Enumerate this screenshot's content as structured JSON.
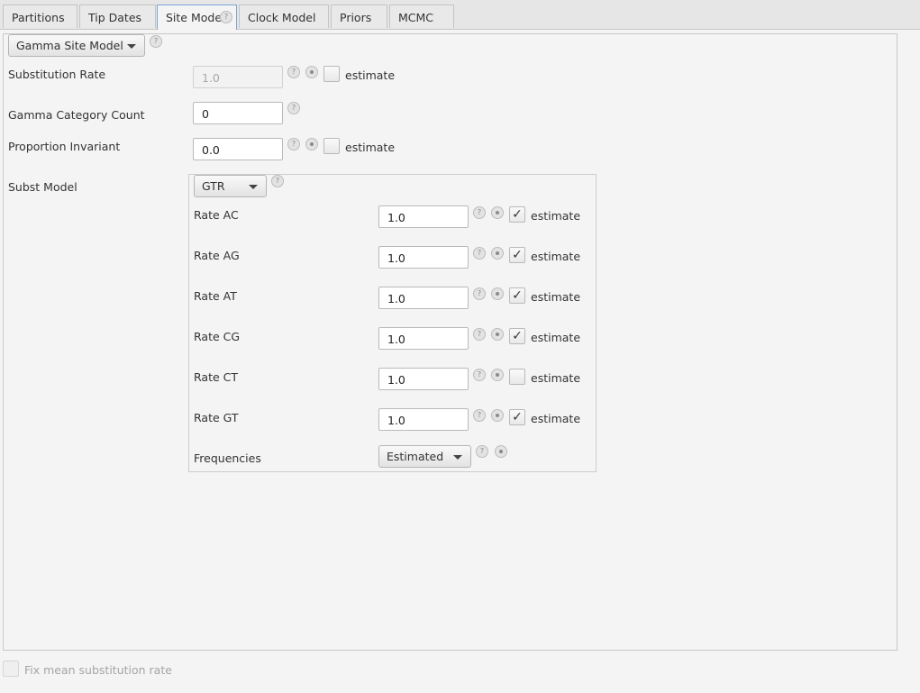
{
  "tabs": [
    {
      "label": "Partitions"
    },
    {
      "label": "Tip Dates"
    },
    {
      "label": "Site Model"
    },
    {
      "label": "Clock Model"
    },
    {
      "label": "Priors"
    },
    {
      "label": "MCMC"
    }
  ],
  "help_glyph": "?",
  "site_model": {
    "selected": "Gamma Site Model",
    "substitution_rate": {
      "label": "Substitution Rate",
      "value": "1.0",
      "enabled": false,
      "estimate": false
    },
    "gamma_category_count": {
      "label": "Gamma Category Count",
      "value": "0"
    },
    "proportion_invariant": {
      "label": "Proportion Invariant",
      "value": "0.0",
      "estimate": false
    },
    "subst_model": {
      "label": "Subst Model",
      "selected": "GTR",
      "rates": [
        {
          "label": "Rate AC",
          "value": "1.0",
          "estimate": true
        },
        {
          "label": "Rate AG",
          "value": "1.0",
          "estimate": true
        },
        {
          "label": "Rate AT",
          "value": "1.0",
          "estimate": true
        },
        {
          "label": "Rate CG",
          "value": "1.0",
          "estimate": true
        },
        {
          "label": "Rate CT",
          "value": "1.0",
          "estimate": false
        },
        {
          "label": "Rate GT",
          "value": "1.0",
          "estimate": true
        }
      ],
      "frequencies": {
        "label": "Frequencies",
        "selected": "Estimated"
      }
    },
    "estimate_label": "estimate"
  },
  "footer": {
    "fix_mean_label": "Fix mean substitution rate",
    "fix_mean_checked": false
  },
  "check_mark": "✓"
}
